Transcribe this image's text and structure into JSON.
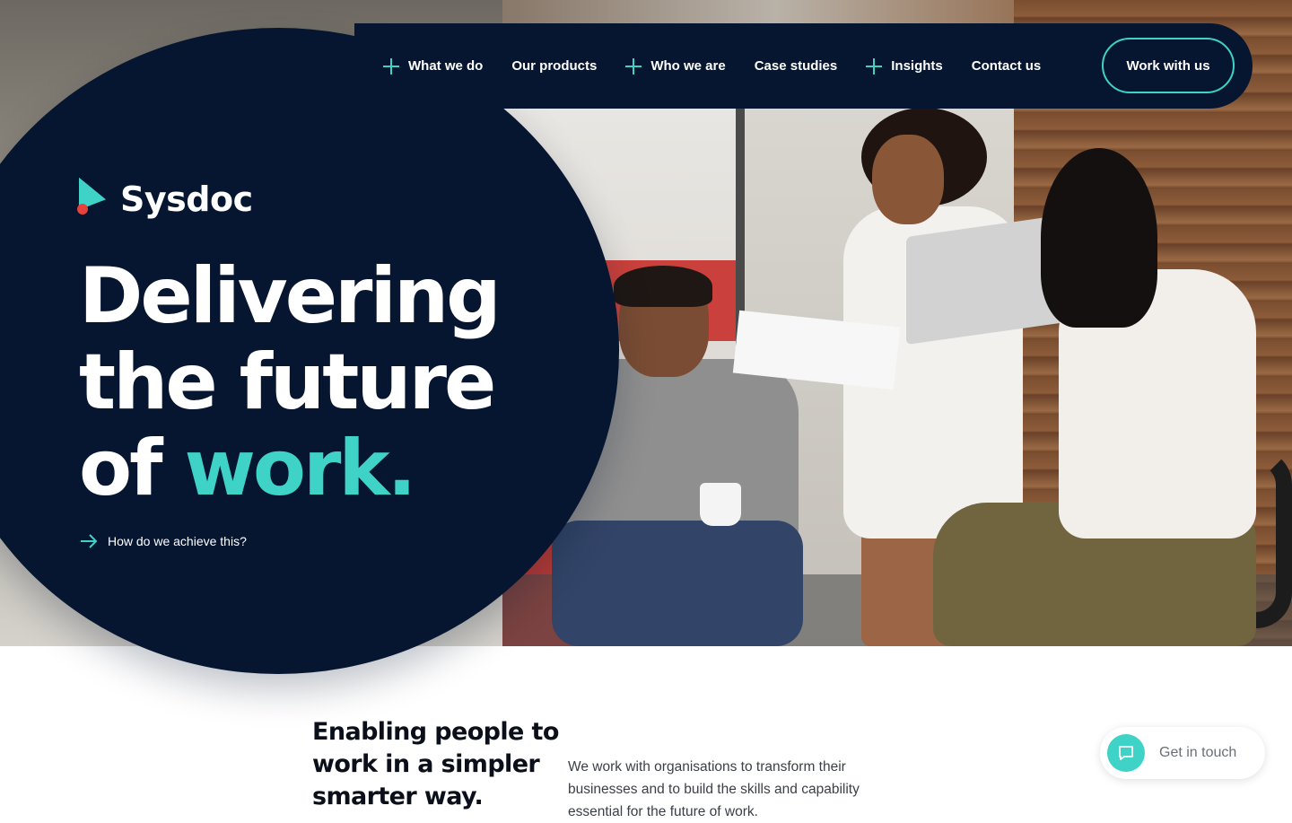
{
  "nav": {
    "items": [
      {
        "label": "What we do",
        "has_plus": true
      },
      {
        "label": "Our products",
        "has_plus": false
      },
      {
        "label": "Who we are",
        "has_plus": true
      },
      {
        "label": "Case studies",
        "has_plus": false
      },
      {
        "label": "Insights",
        "has_plus": true
      },
      {
        "label": "Contact us",
        "has_plus": false
      }
    ],
    "cta_label": "Work with us"
  },
  "brand": {
    "name": "Sysdoc"
  },
  "hero": {
    "line1": "Delivering",
    "line2": "the future",
    "line3_prefix": "of ",
    "line3_accent": "work.",
    "link_label": "How do we achieve this?"
  },
  "intro": {
    "title": "Enabling people to work in a simpler smarter way.",
    "text": "We work with organisations to transform their businesses and to build the skills and capability essential for the future of work."
  },
  "chat": {
    "label": "Get in touch"
  },
  "colors": {
    "navy": "#061630",
    "accent": "#3fd2c7",
    "logo_dot": "#e8413c"
  },
  "icons": [
    "plus-icon",
    "arrow-right-icon",
    "chat-bubble-icon",
    "logo-mark"
  ]
}
